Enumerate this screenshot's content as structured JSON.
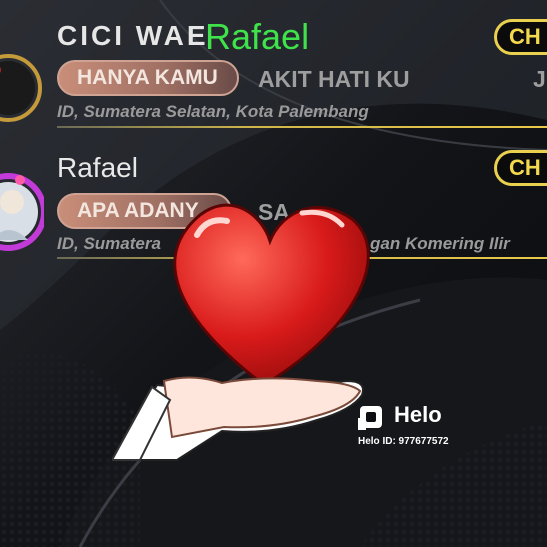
{
  "rows": [
    {
      "name": "CICI WAE",
      "pill_label": "HANYA KAMU",
      "marquee": "AKIT HATI KU",
      "marquee_tail": "J",
      "location": "ID, Sumatera Selatan, Kota Palembang",
      "badge": "CH"
    },
    {
      "name": "Rafael",
      "pill_label": "APA ADANY",
      "marquee": "SA",
      "location_start": "ID, Sumatera",
      "location_end": "gan Komering Ilir",
      "badge": "CH"
    }
  ],
  "overlay_name": "Rafael",
  "overlay_name_color": "#3fe24a",
  "sticker": {
    "icon": "heart-in-hand-icon"
  },
  "watermark": {
    "brand": "Helo",
    "id_text": "Helo ID: 977677572"
  },
  "colors": {
    "accent_gold": "#e9d14f",
    "pill": "#b37f6f",
    "background": "#0c0e12"
  }
}
